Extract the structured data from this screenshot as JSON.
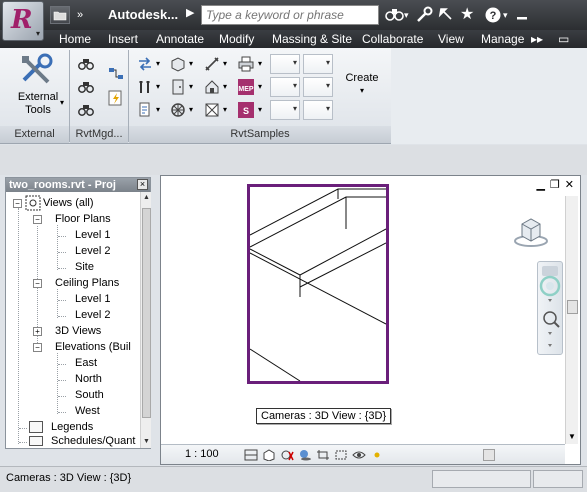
{
  "titlebar": {
    "app_title": "Autodesk...",
    "search_placeholder": "Type a keyword or phrase"
  },
  "ribbon": {
    "tabs": [
      "Home",
      "Insert",
      "Annotate",
      "Modify",
      "Massing & Site",
      "Collaborate",
      "View",
      "Manage"
    ],
    "active_tab": "Home",
    "external_tools_label": "External Tools",
    "create_label": "Create",
    "panels": [
      "External",
      "RvtMgd...",
      "RvtSamples"
    ]
  },
  "browser": {
    "title": "two_rooms.rvt - Proj",
    "tree": {
      "views_all": "Views (all)",
      "floor_plans": "Floor Plans",
      "fp_level1": "Level 1",
      "fp_level2": "Level 2",
      "fp_site": "Site",
      "ceiling_plans": "Ceiling Plans",
      "cp_level1": "Level 1",
      "cp_level2": "Level 2",
      "views_3d": "3D Views",
      "elevations": "Elevations (Buil",
      "east": "East",
      "north": "North",
      "south": "South",
      "west": "West",
      "legends": "Legends",
      "schedules": "Schedules/Quant"
    }
  },
  "view": {
    "tooltip": "Cameras : 3D View : {3D}",
    "scale": "1 : 100"
  },
  "status": {
    "text": "Cameras : 3D View : {3D}"
  },
  "colors": {
    "crop_region": "#6a1f7a",
    "titlebar_dark": "#2c2e31",
    "app_logo": "#a0206a"
  }
}
